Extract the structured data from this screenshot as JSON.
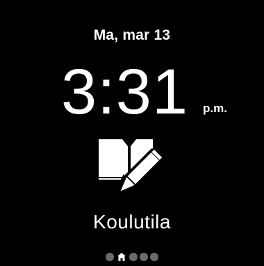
{
  "date": "Ma, mar 13",
  "time": "3:31",
  "ampm": "p.m.",
  "mode": {
    "label": "Koulutila",
    "icon": "book-pencil-icon"
  },
  "pager": {
    "pages": 5,
    "active_index": 1,
    "active_icon": "home-icon"
  },
  "colors": {
    "background": "#000000",
    "text": "#ffffff",
    "inactive_dot": "#6b6b6b"
  }
}
